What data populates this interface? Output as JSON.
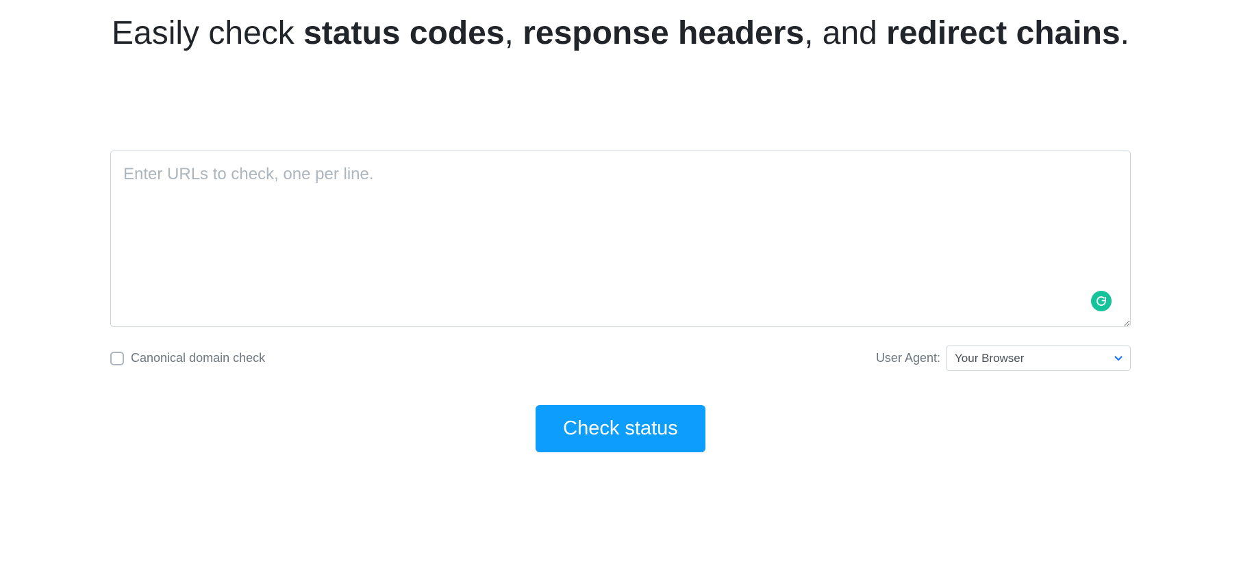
{
  "headline": {
    "pre": "Easily check ",
    "b1": "status codes",
    "mid1": ", ",
    "b2": "response headers",
    "mid2": ", and ",
    "b3": "redirect chains",
    "post": "."
  },
  "textarea": {
    "placeholder": "Enter URLs to check, one per line.",
    "value": ""
  },
  "options": {
    "canonical_label": "Canonical domain check",
    "canonical_checked": false,
    "user_agent_label": "User Agent:",
    "user_agent_selected": "Your Browser"
  },
  "submit": {
    "label": "Check status"
  },
  "badge": {
    "name": "grammarly"
  }
}
